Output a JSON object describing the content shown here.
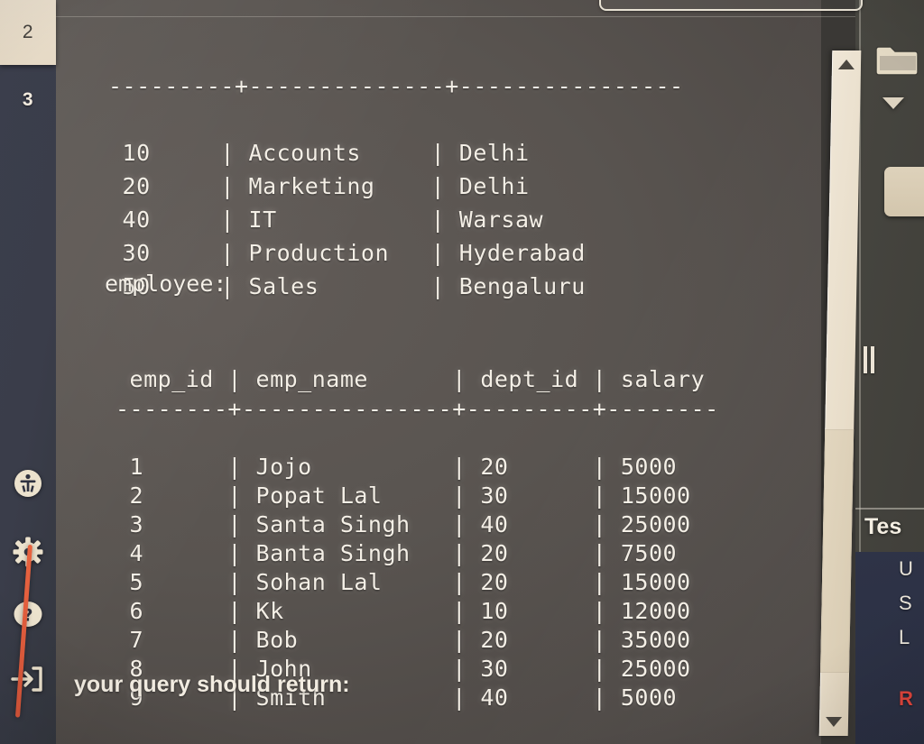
{
  "sidebar": {
    "tabs": [
      {
        "label": "2",
        "state": "active"
      },
      {
        "label": "3",
        "state": "inactive"
      }
    ],
    "icons": [
      {
        "name": "accessibility-icon",
        "label": "Accessibility"
      },
      {
        "name": "gear-icon",
        "label": "Settings"
      },
      {
        "name": "help-icon",
        "label": "Help"
      },
      {
        "name": "sign-in-icon",
        "label": "Sign in"
      }
    ]
  },
  "console": {
    "department": {
      "separator": "---------+--------------+----------------",
      "rows": [
        {
          "dept_id": "10",
          "dept_name": "Accounts",
          "location": "Delhi"
        },
        {
          "dept_id": "20",
          "dept_name": "Marketing",
          "location": "Delhi"
        },
        {
          "dept_id": "40",
          "dept_name": "IT",
          "location": "Warsaw"
        },
        {
          "dept_id": "30",
          "dept_name": "Production",
          "location": "Hyderabad"
        },
        {
          "dept_id": "50",
          "dept_name": "Sales",
          "location": "Bengaluru"
        }
      ]
    },
    "employee_label": "employee:",
    "employee": {
      "headers": [
        "emp_id",
        "emp_name",
        "dept_id",
        "salary"
      ],
      "header_line": " emp_id | emp_name      | dept_id | salary",
      "separator": "--------+---------------+---------+--------",
      "rows": [
        {
          "emp_id": "1",
          "emp_name": "Jojo",
          "dept_id": "20",
          "salary": "5000"
        },
        {
          "emp_id": "2",
          "emp_name": "Popat Lal",
          "dept_id": "30",
          "salary": "15000"
        },
        {
          "emp_id": "3",
          "emp_name": "Santa Singh",
          "dept_id": "40",
          "salary": "25000"
        },
        {
          "emp_id": "4",
          "emp_name": "Banta Singh",
          "dept_id": "20",
          "salary": "7500"
        },
        {
          "emp_id": "5",
          "emp_name": "Sohan Lal",
          "dept_id": "20",
          "salary": "15000"
        },
        {
          "emp_id": "6",
          "emp_name": "Kk",
          "dept_id": "10",
          "salary": "12000"
        },
        {
          "emp_id": "7",
          "emp_name": "Bob",
          "dept_id": "20",
          "salary": "35000"
        },
        {
          "emp_id": "8",
          "emp_name": "John",
          "dept_id": "30",
          "salary": "25000"
        },
        {
          "emp_id": "9",
          "emp_name": "Smith",
          "dept_id": "40",
          "salary": "5000"
        }
      ]
    },
    "footer_note": "your query should return:"
  },
  "right_panel": {
    "title": "Tes",
    "lines": [
      "U",
      "S",
      "L"
    ],
    "red_text": "R"
  },
  "colors": {
    "console_bg": "#595450",
    "rail_bg": "#3a3d4a",
    "active_tab_bg": "#e5d9c5",
    "text": "#f4efe6",
    "scrollbar": "#e8ddc9",
    "panel_body_bg": "#2a2f42",
    "red_accent": "#e0453c",
    "cable": "#e8633f"
  }
}
